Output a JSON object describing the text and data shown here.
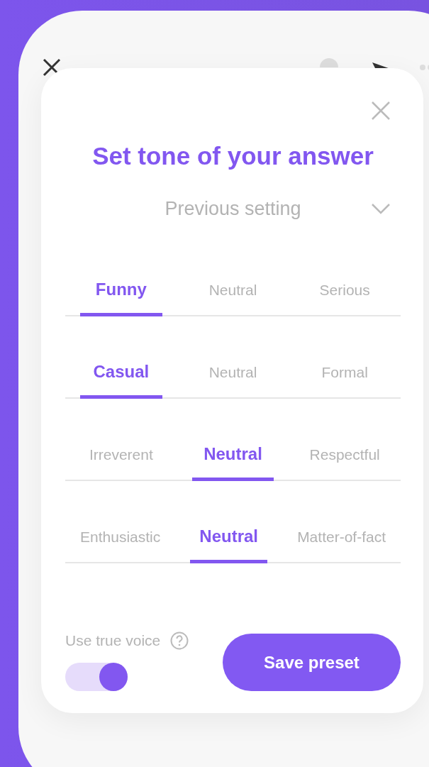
{
  "modal": {
    "title": "Set tone of your answer",
    "preset_dropdown": {
      "value": "Previous setting"
    },
    "tone_rows": [
      {
        "options": [
          {
            "label": "Funny",
            "selected": true
          },
          {
            "label": "Neutral",
            "selected": false
          },
          {
            "label": "Serious",
            "selected": false
          }
        ]
      },
      {
        "options": [
          {
            "label": "Casual",
            "selected": true
          },
          {
            "label": "Neutral",
            "selected": false
          },
          {
            "label": "Formal",
            "selected": false
          }
        ]
      },
      {
        "options": [
          {
            "label": "Irreverent",
            "selected": false
          },
          {
            "label": "Neutral",
            "selected": true
          },
          {
            "label": "Respectful",
            "selected": false
          }
        ]
      },
      {
        "options": [
          {
            "label": "Enthusiastic",
            "selected": false
          },
          {
            "label": "Neutral",
            "selected": true
          },
          {
            "label": "Matter-of-fact",
            "selected": false
          }
        ]
      }
    ],
    "true_voice": {
      "label": "Use true voice",
      "on": true
    },
    "save_button": "Save preset"
  }
}
